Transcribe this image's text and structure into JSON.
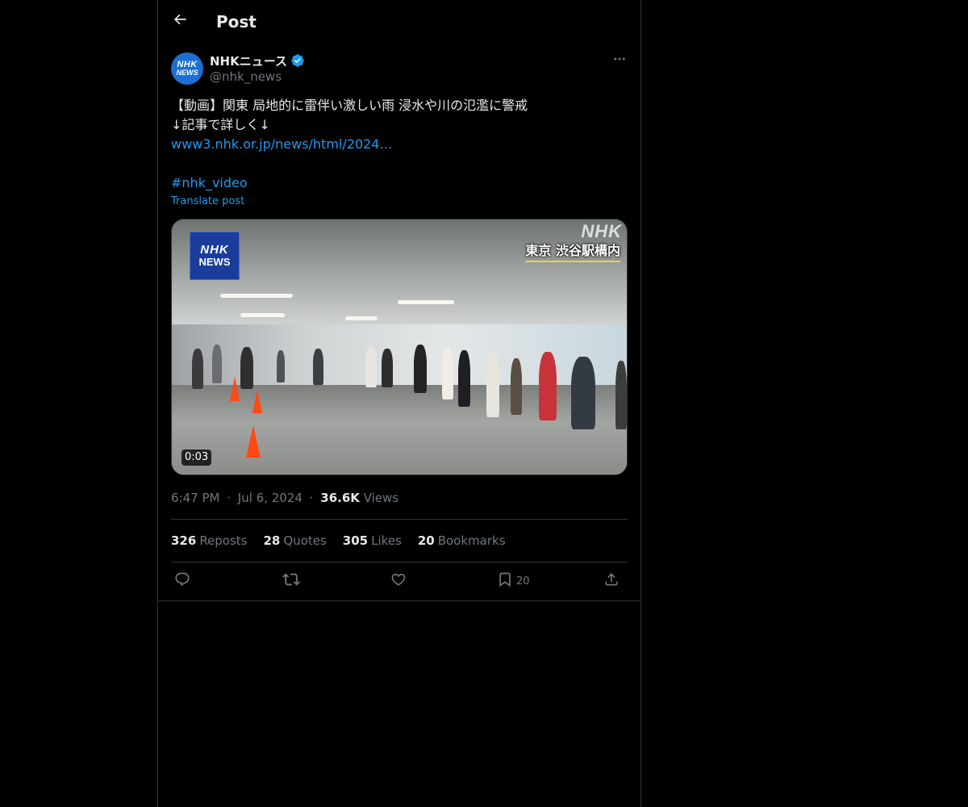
{
  "header": {
    "title": "Post"
  },
  "author": {
    "display_name": "NHKニュース",
    "handle": "@nhk_news",
    "avatar_line1": "NHK",
    "avatar_line2": "NEWS",
    "verified": true
  },
  "post": {
    "line1": "【動画】関東 局地的に雷伴い激しい雨 浸水や川の氾濫に警戒",
    "line2": "↓記事で詳しく↓",
    "link": "www3.nhk.or.jp/news/html/2024…",
    "hashtag": "#nhk_video",
    "translate_label": "Translate post"
  },
  "media": {
    "badge_line1": "NHK",
    "badge_line2": "NEWS",
    "watermark": "NHK",
    "location_caption": "東京 渋谷駅構内",
    "duration": "0:03"
  },
  "meta": {
    "time": "6:47 PM",
    "date": "Jul 6, 2024",
    "separator": "·",
    "views_count": "36.6K",
    "views_label": "Views"
  },
  "stats": {
    "reposts_count": "326",
    "reposts_label": "Reposts",
    "quotes_count": "28",
    "quotes_label": "Quotes",
    "likes_count": "305",
    "likes_label": "Likes",
    "bookmarks_count": "20",
    "bookmarks_label": "Bookmarks"
  },
  "actions": {
    "bookmark_count": "20"
  },
  "colors": {
    "background": "#000000",
    "text_primary": "#e7e9ea",
    "text_secondary": "#71767b",
    "link": "#1d9bf0",
    "border": "#2f3336",
    "verified": "#1d9bf0"
  }
}
